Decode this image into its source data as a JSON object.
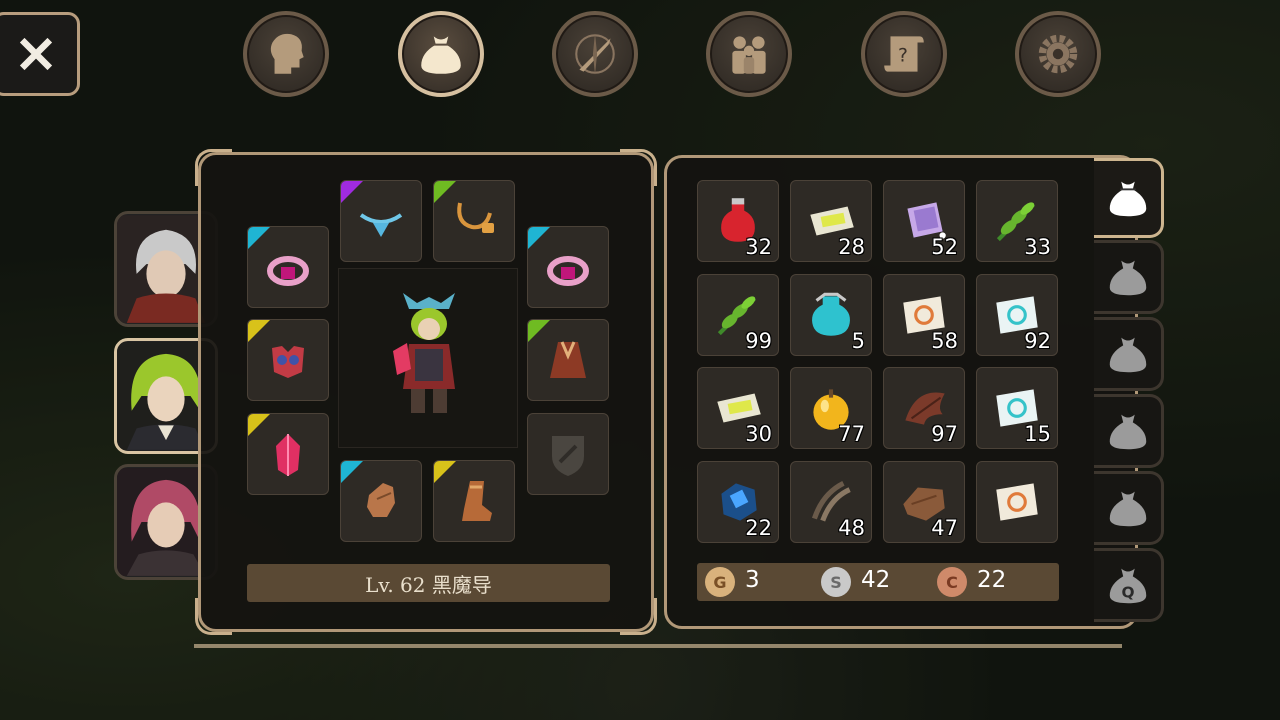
{
  "top_tabs": [
    {
      "name": "character",
      "icon": "head-icon",
      "active": false
    },
    {
      "name": "inventory",
      "icon": "bag-icon",
      "active": true
    },
    {
      "name": "skills",
      "icon": "compass-sword-icon",
      "active": false
    },
    {
      "name": "party",
      "icon": "people-icon",
      "active": false
    },
    {
      "name": "quests",
      "icon": "quest-scroll-icon",
      "active": false
    },
    {
      "name": "settings",
      "icon": "gear-icon",
      "active": false
    }
  ],
  "equipment": {
    "level_label": "Lv. 62 黑魔导",
    "rarity_colors": {
      "cyan": "#1fb5d3",
      "purple": "#a02be0",
      "green": "#6fbb22",
      "yellow": "#d8c21a"
    }
  },
  "inventory": {
    "items": [
      {
        "icon": "red-potion-icon",
        "qty": "32"
      },
      {
        "icon": "yellow-scroll-icon",
        "qty": "28"
      },
      {
        "icon": "crystal-book-icon",
        "qty": "52"
      },
      {
        "icon": "green-herb-icon",
        "qty": "33"
      },
      {
        "icon": "green-herb-icon",
        "qty": "99"
      },
      {
        "icon": "cyan-potion-icon",
        "qty": "5"
      },
      {
        "icon": "orange-map-icon",
        "qty": "58"
      },
      {
        "icon": "cyan-map-icon",
        "qty": "92"
      },
      {
        "icon": "yellow-scroll-icon",
        "qty": "30"
      },
      {
        "icon": "golden-apple-icon",
        "qty": "77"
      },
      {
        "icon": "feather-wing-icon",
        "qty": "97"
      },
      {
        "icon": "cyan-map-icon",
        "qty": "15"
      },
      {
        "icon": "blue-ore-icon",
        "qty": "22"
      },
      {
        "icon": "claw-icon",
        "qty": "48"
      },
      {
        "icon": "leather-icon",
        "qty": "47"
      },
      {
        "icon": "orange-map-icon",
        "qty": ""
      }
    ],
    "currency": {
      "gold": {
        "symbol": "G",
        "value": "3"
      },
      "silver": {
        "symbol": "S",
        "value": "42"
      },
      "copper": {
        "symbol": "C",
        "value": "22"
      }
    }
  },
  "side_tabs": [
    {
      "icon": "bag-icon",
      "active": true
    },
    {
      "icon": "bag-icon",
      "active": false
    },
    {
      "icon": "bag-icon",
      "active": false
    },
    {
      "icon": "bag-icon",
      "active": false
    },
    {
      "icon": "bag-icon",
      "active": false
    },
    {
      "icon": "quest-bag-icon",
      "label": "Q",
      "active": false
    }
  ]
}
